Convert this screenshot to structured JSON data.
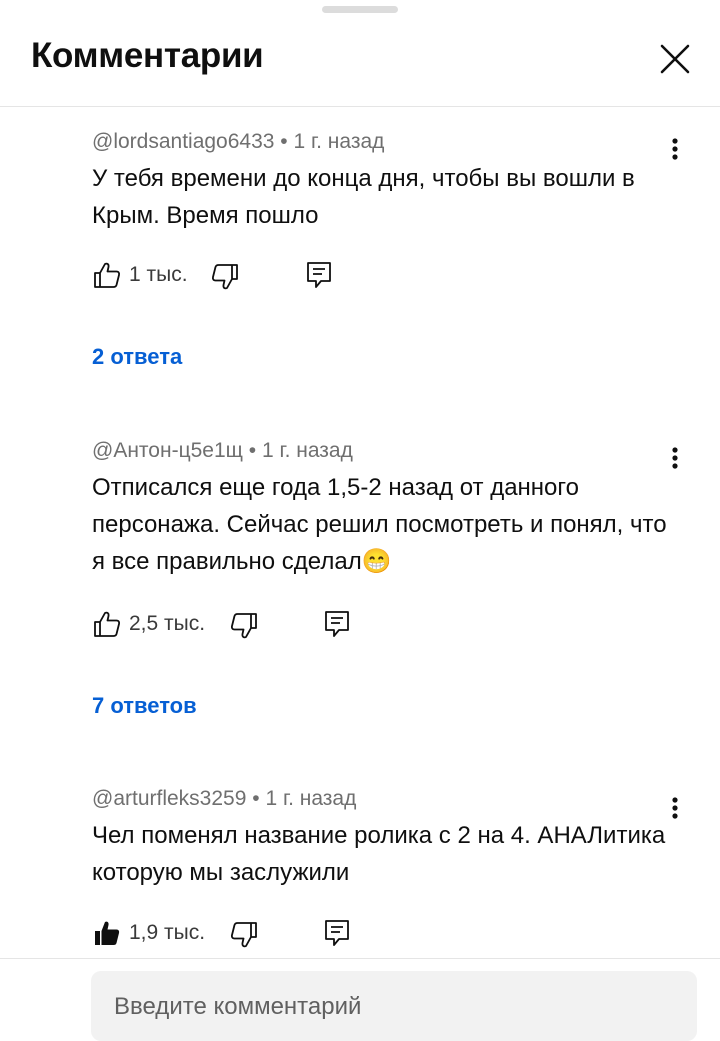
{
  "header": {
    "title": "Комментарии"
  },
  "comments": [
    {
      "author": "@lordsantiago6433",
      "time": "1 г. назад",
      "text": "У тебя времени до конца дня, чтобы вы вошли в Крым. Время пошло",
      "likes": "1 тыс.",
      "liked": false,
      "replies": "2 ответа"
    },
    {
      "author": "@Антон-ц5е1щ",
      "time": "1 г. назад",
      "text": "Отписался еще года 1,5-2 назад от данного персонажа. Сейчас решил посмотреть и понял, что я все правильно сделал😁",
      "likes": "2,5 тыс.",
      "liked": false,
      "replies": "7 ответов"
    },
    {
      "author": "@arturfleks3259",
      "time": "1 г. назад",
      "text": "Чел поменял название ролика с 2 на 4. АНАЛитика которую мы заслужили",
      "likes": "1,9 тыс.",
      "liked": true
    }
  ],
  "composer": {
    "placeholder": "Введите комментарий"
  },
  "separator": "•",
  "icons": {
    "close": "close-icon",
    "more": "more-vertical-icon",
    "like": "thumb-up-icon",
    "dislike": "thumb-down-icon",
    "reply": "reply-icon"
  }
}
